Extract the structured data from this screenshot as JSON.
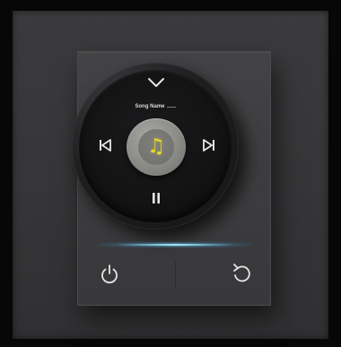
{
  "knob": {
    "song_name": "Song Name"
  },
  "icons": {
    "collapse": "chevron-down-icon",
    "previous": "skip-previous-icon",
    "next": "skip-next-icon",
    "pause": "pause-icon",
    "now_playing": "music-note-icon",
    "power": "power-icon",
    "repeat": "rotate-icon"
  },
  "colors": {
    "accent_yellow": "#e4d928",
    "glow_blue": "#9fe2f5",
    "icon_white": "#e6e6e6"
  }
}
